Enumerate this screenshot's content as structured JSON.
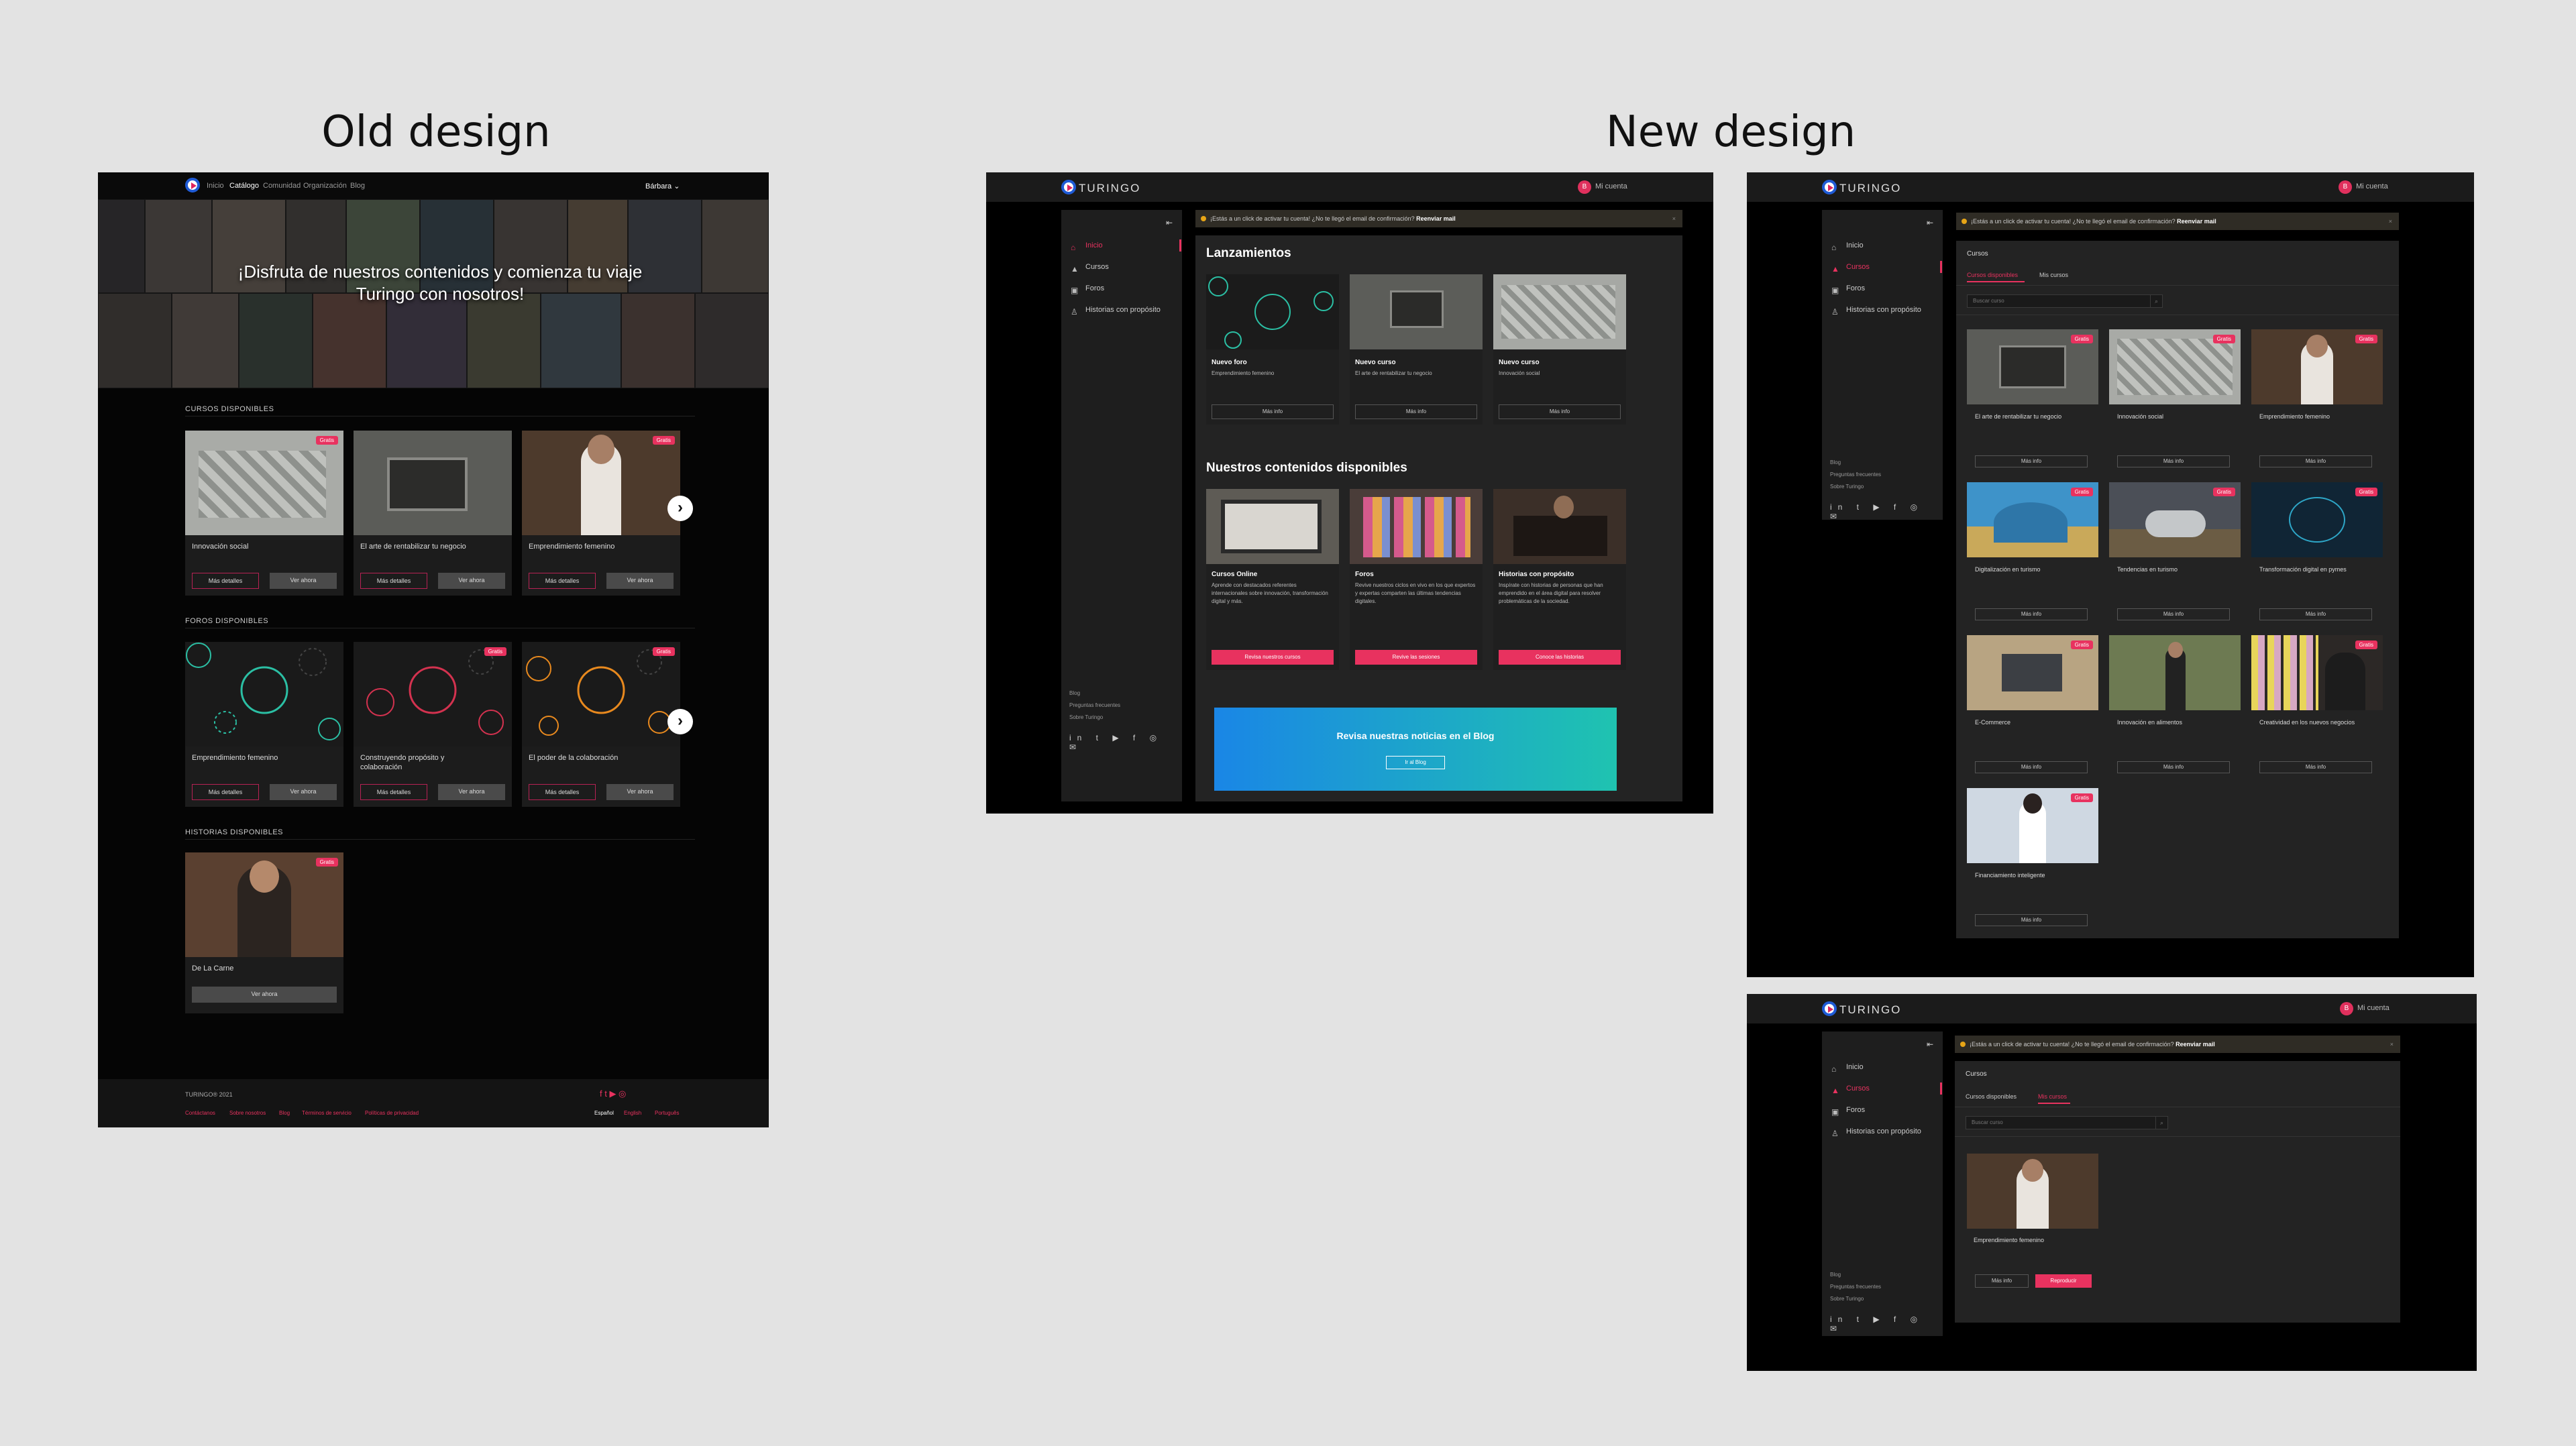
{
  "titles": {
    "old": "Old design",
    "new": "New design"
  },
  "old": {
    "nav": [
      "Inicio",
      "Catálogo",
      "Comunidad",
      "Organización",
      "Blog"
    ],
    "user": "Bárbara ⌄",
    "hero": "¡Disfruta de nuestros contenidos y comienza tu viaje Turingo con nosotros!",
    "sections": {
      "cursos": "CURSOS DISPONIBLES",
      "foros": "FOROS DISPONIBLES",
      "historias": "HISTORIAS DISPONIBLES"
    },
    "cursos": [
      "Innovación social",
      "El arte de rentabilizar tu negocio",
      "Emprendimiento femenino"
    ],
    "foros": [
      "Emprendimiento femenino",
      "Construyendo propósito y colaboración",
      "El poder de la colaboración"
    ],
    "historia": "De La Carne",
    "btn_more": "Más detalles",
    "btn_now": "Ver ahora",
    "badge": "Gratis",
    "arrow": "›",
    "footer": {
      "copy": "TURINGO® 2021",
      "links": [
        "Contáctanos",
        "Sobre nosotros",
        "Blog",
        "Términos de servicio",
        "Políticas de privacidad"
      ],
      "langs": [
        "Español",
        "English",
        "Português"
      ],
      "social": "f  t  ▶  ◎"
    }
  },
  "new": {
    "brand": "TURINGO",
    "account": "Mi cuenta",
    "avatar": "B",
    "nav": [
      "Inicio",
      "Cursos",
      "Foros",
      "Historias con propósito"
    ],
    "nav_icons": [
      "⌂",
      "▲",
      "▣",
      "♙"
    ],
    "footer_links": [
      "Blog",
      "Preguntas frecuentes",
      "Sobre Turingo"
    ],
    "social": "in t ▶ f ◎ ✉",
    "collapse": "⇤",
    "banner_text": "¡Estás a un click de activar tu cuenta! ¿No te llegó el email de confirmación?",
    "banner_link": "Reenviar mail",
    "banner_close": "×",
    "lanz_title": "Lanzamientos",
    "lanz": [
      {
        "t": "Nuevo foro",
        "d": "Emprendimiento femenino"
      },
      {
        "t": "Nuevo curso",
        "d": "El arte de rentabilizar tu negocio"
      },
      {
        "t": "Nuevo curso",
        "d": "Innovación social"
      }
    ],
    "mas_info": "Más info",
    "disp_title": "Nuestros contenidos disponibles",
    "disp": [
      {
        "t": "Cursos Online",
        "d": "Aprende con destacados referentes internacionales sobre innovación, transformación digital y más.",
        "b": "Revisa nuestros cursos"
      },
      {
        "t": "Foros",
        "d": "Revive nuestros ciclos en vivo en los que expertos y expertas comparten las últimas tendencias digitales.",
        "b": "Revive las sesiones"
      },
      {
        "t": "Historias con propósito",
        "d": "Inspírate con historias de personas que han emprendido en el área digital para resolver problemáticas de la sociedad.",
        "b": "Conoce las historias"
      }
    ],
    "blog_title": "Revisa nuestras noticias en el Blog",
    "blog_btn": "Ir al Blog",
    "cursos_title": "Cursos",
    "tab_disp": "Cursos disponibles",
    "tab_mis": "Mis cursos",
    "search_ph": "Buscar curso",
    "search_icon": "⌕",
    "badge": "Gratis",
    "cursos": [
      "El arte de rentabilizar tu negocio",
      "Innovación social",
      "Emprendimiento femenino",
      "Digitalización en turismo",
      "Tendencias en turismo",
      "Transformación digital en pymes",
      "E-Commerce",
      "Innovación en alimentos",
      "Creatividad en los nuevos negocios",
      "Financiamiento inteligente"
    ],
    "mis": {
      "t": "Emprendimiento femenino",
      "b1": "Más info",
      "b2": "Reproducir"
    }
  }
}
